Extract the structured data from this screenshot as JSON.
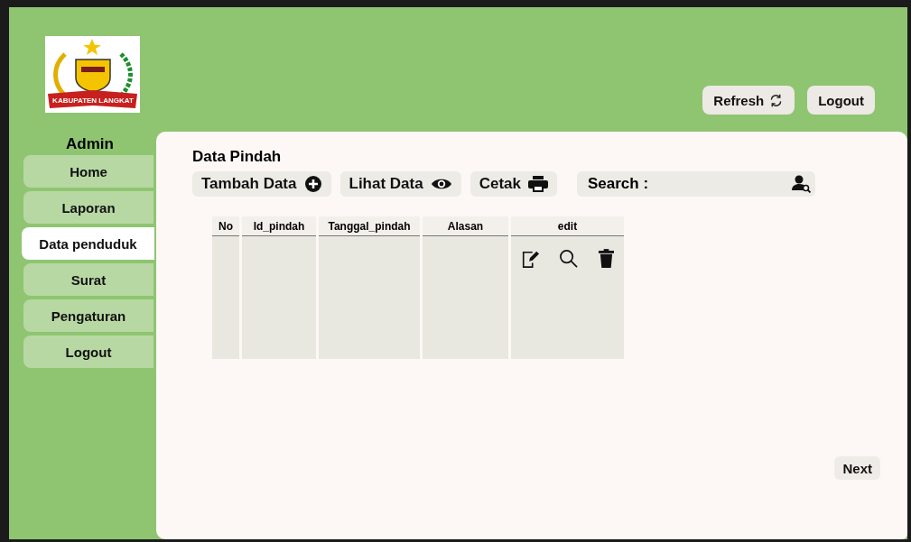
{
  "header": {
    "logo_text": "KABUPATEN LANGKAT",
    "buttons": [
      {
        "label": "Refresh",
        "kind": "refresh"
      },
      {
        "label": "Logout",
        "kind": "plain"
      }
    ]
  },
  "sidebar": {
    "title": "Admin",
    "items": [
      {
        "label": "Home",
        "selected": false
      },
      {
        "label": "Laporan",
        "selected": false
      },
      {
        "label": "Data penduduk",
        "selected": true
      },
      {
        "label": "Surat",
        "selected": false
      },
      {
        "label": "Pengaturan",
        "selected": false
      },
      {
        "label": "Logout",
        "selected": false
      }
    ]
  },
  "main": {
    "title": "Data Pindah",
    "toolbar": [
      {
        "label": "Tambah Data",
        "kind": "add"
      },
      {
        "label": "Lihat Data",
        "kind": "view"
      },
      {
        "label": "Cetak",
        "kind": "print"
      }
    ],
    "search": {
      "label": "Search :"
    },
    "table": {
      "columns": [
        "No",
        "Id_pindah",
        "Tanggal_pindah",
        "Alasan",
        "edit"
      ]
    },
    "next_button": "Next"
  }
}
